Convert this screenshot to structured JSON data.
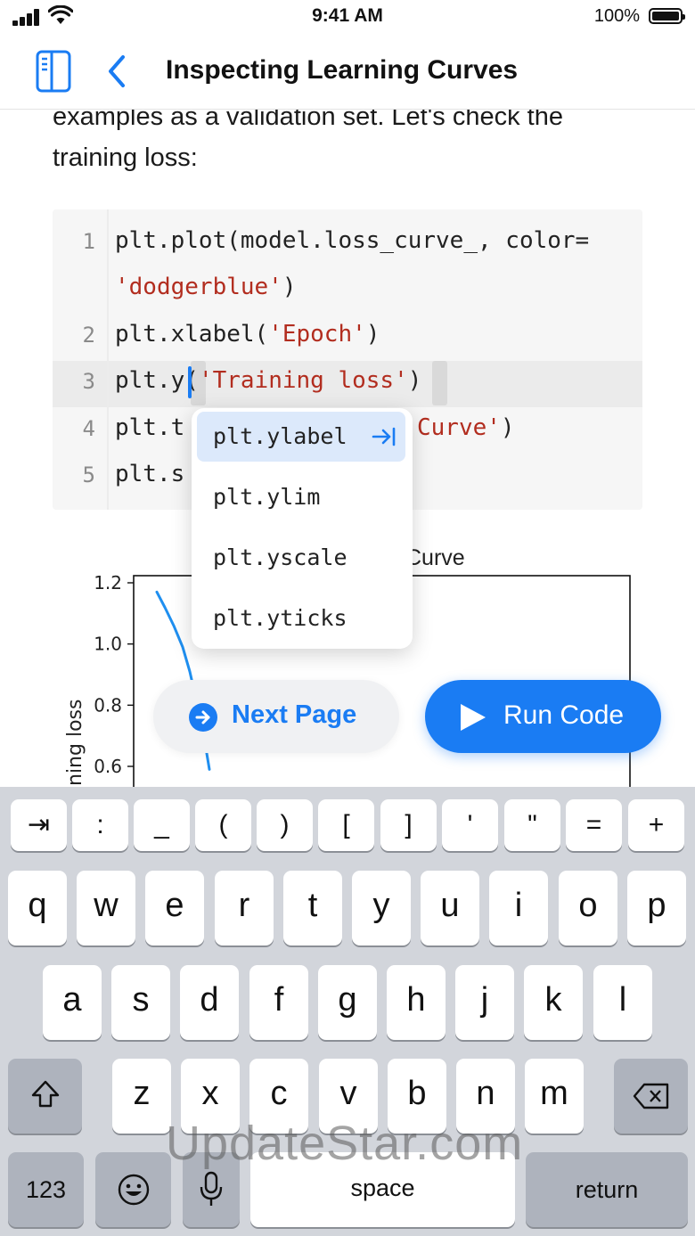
{
  "status_bar": {
    "time": "9:41 AM",
    "battery": "100%"
  },
  "nav": {
    "title": "Inspecting Learning Curves",
    "sidebar_icon": "sidebar-icon",
    "back_icon": "chevron-left-icon"
  },
  "intro": {
    "line1": "examples as a validation set. Let's check the",
    "line2": "training loss:"
  },
  "code": {
    "line_numbers": [
      "1",
      "2",
      "3",
      "4",
      "5"
    ],
    "line1a": "plt.plot(model.loss_curve_, color=",
    "line1b": "'dodgerblue'",
    "line1b_end": ")",
    "line2a": "plt.xlabel(",
    "line2b": "'Epoch'",
    "line2c": ")",
    "line3a": "plt.y",
    "line3b": "(",
    "line3c": "'Training loss'",
    "line3d": ")",
    "line4a": "plt.t",
    "line4b": "Curve'",
    "line4c": ")",
    "line5a": "plt.s"
  },
  "autocomplete": {
    "items": [
      "plt.ylabel",
      "plt.ylim",
      "plt.yscale",
      "plt.yticks"
    ],
    "selected_index": 0,
    "accept_icon": "tab-arrow-icon"
  },
  "chart_data": {
    "type": "line",
    "title": "Curve",
    "ylabel": "ning loss",
    "ytick_labels": [
      "1.2",
      "1.0",
      "0.8",
      "0.6"
    ],
    "ylim": [
      0.55,
      1.2
    ],
    "series": [
      {
        "values": [
          1.17,
          1.12,
          1.06,
          0.99,
          0.91,
          0.82,
          0.74,
          0.66,
          0.59
        ]
      }
    ],
    "color": "#1f8ff0"
  },
  "buttons": {
    "next_page": "Next Page",
    "run_code": "Run Code"
  },
  "keyboard": {
    "row_symbols": [
      "⇥",
      ":",
      "_",
      "(",
      ")",
      "[",
      "]",
      "'",
      "\"",
      "=",
      "+"
    ],
    "row1": [
      "q",
      "w",
      "e",
      "r",
      "t",
      "y",
      "u",
      "i",
      "o",
      "p"
    ],
    "row2": [
      "a",
      "s",
      "d",
      "f",
      "g",
      "h",
      "j",
      "k",
      "l"
    ],
    "row3": [
      "z",
      "x",
      "c",
      "v",
      "b",
      "n",
      "m"
    ],
    "numbers_key": "123",
    "space_key": "space",
    "return_key": "return"
  },
  "watermark": "UpdateStar.com",
  "colors": {
    "accent": "#1a7cf3",
    "string": "#b22d1f",
    "keyboard_bg": "#d2d5db"
  }
}
